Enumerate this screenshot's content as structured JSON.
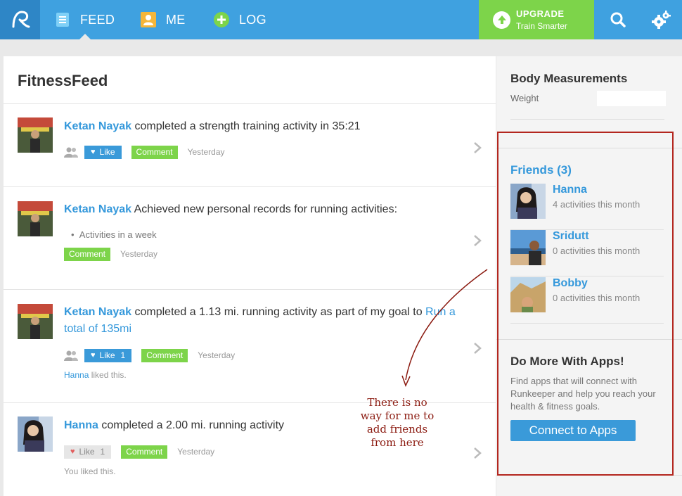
{
  "nav": {
    "items": [
      {
        "label": "FEED",
        "icon": "feed-icon"
      },
      {
        "label": "ME",
        "icon": "profile-icon"
      },
      {
        "label": "LOG",
        "icon": "plus-icon"
      }
    ],
    "upgrade": {
      "title": "UPGRADE",
      "subtitle": "Train Smarter"
    }
  },
  "colors": {
    "nav_blue": "#3fa1e0",
    "logo_blue": "#2e86c6",
    "upgrade_green": "#7dd44a",
    "link_blue": "#3498db",
    "annotation_red": "#b3261e"
  },
  "feed": {
    "title": "FitnessFeed",
    "items": [
      {
        "name": "Ketan Nayak",
        "text": " completed a strength training activity in 35:21",
        "like_label": "Like",
        "comment_label": "Comment",
        "time": "Yesterday"
      },
      {
        "name": "Ketan Nayak",
        "text": " Achieved new personal records for running activities:",
        "bullet": "Activities in a week",
        "comment_label": "Comment",
        "time": "Yesterday"
      },
      {
        "name": "Ketan Nayak",
        "text": " completed a 1.13 mi. running activity as part of my goal to ",
        "goal_link": "Run a total of 135mi",
        "like_label": "Like",
        "like_count": "1",
        "comment_label": "Comment",
        "time": "Yesterday",
        "liked_by_name": "Hanna",
        "liked_by_suffix": " liked this."
      },
      {
        "name": "Hanna",
        "text": " completed a 2.00 mi. running activity",
        "like_label": "Like",
        "like_count": "1",
        "comment_label": "Comment",
        "time": "Yesterday",
        "liked_text": "You liked this."
      }
    ]
  },
  "sidebar": {
    "body_measurements": {
      "title": "Body Measurements",
      "weight_label": "Weight",
      "weight_value": ""
    },
    "friends": {
      "title": "Friends (3)",
      "list": [
        {
          "name": "Hanna",
          "activity": "4 activities this month"
        },
        {
          "name": "Sridutt",
          "activity": "0 activities this month"
        },
        {
          "name": "Bobby",
          "activity": "0 activities this month"
        }
      ]
    },
    "apps": {
      "title": "Do More With Apps!",
      "description": "Find apps that will connect with Runkeeper and help you reach your health & fitness goals.",
      "button": "Connect to Apps"
    }
  },
  "annotation": {
    "text": "There is no way for me to add friends from here"
  }
}
